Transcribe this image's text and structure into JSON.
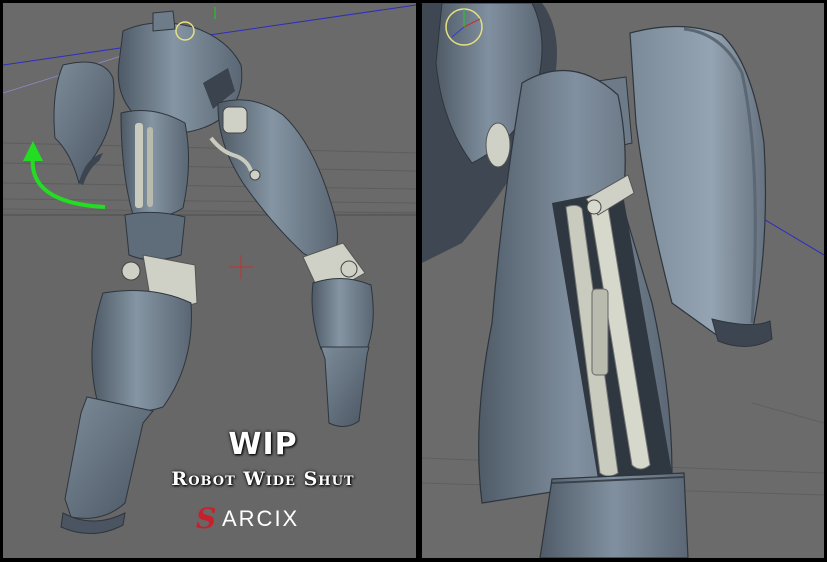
{
  "caption": {
    "title": "WIP",
    "subtitle": "Robot Wide Shut"
  },
  "logo": {
    "mark": "S",
    "text": "ARCIX",
    "mark_color": "#c8202a"
  },
  "colors": {
    "viewport_bg": "#6b6b6b",
    "robot_metal": "#6f7e8c",
    "robot_dark": "#3f4955",
    "piston": "#c9cbbf",
    "rotate_arrow": "#22dd22",
    "selection_ring": "#e8e080"
  },
  "icons": {
    "rotate_arrow": "rotate-arrow-icon",
    "selection_ring": "selection-ring-icon",
    "axis_gizmo": "axis-gizmo-icon"
  }
}
